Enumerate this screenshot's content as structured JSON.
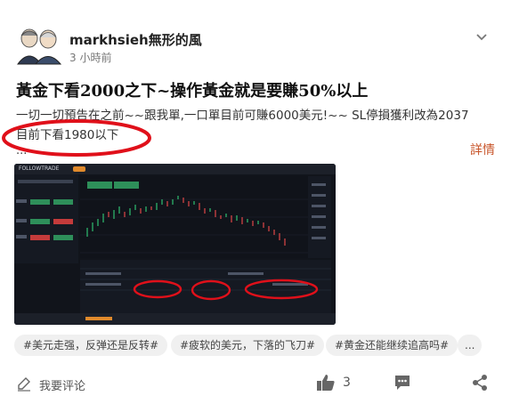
{
  "post": {
    "author": "markhsieh無形的風",
    "time": "3 小時前",
    "title": "黃金下看2000之下~操作黃金就是要賺50%以上",
    "body_line1": "一切一切預告在之前~~跟我單,一口單目前可賺6000美元!~~ SL停損獲利改為2037",
    "body_line2": "目前下看1980以下",
    "ellipsis": "...",
    "more_label": "詳情"
  },
  "screenshot": {
    "logo_text": "FOLLOWTRADE"
  },
  "tags": [
    "#美元走强，反弹还是反转#",
    "#疲软的美元，下落的飞刀#",
    "#黄金还能继续追高吗#",
    "..."
  ],
  "footer": {
    "comment_label": "我要评论",
    "like_count": "3"
  },
  "colors": {
    "accent": "#c8552a",
    "annotation_red": "#e0101a",
    "chart_bg": "#11141b",
    "candle_up": "#2fbf71",
    "candle_down": "#e04848"
  },
  "icons": [
    "chevron-down-icon",
    "comment-pen-icon",
    "thumbs-up-icon",
    "chat-bubble-icon",
    "share-icon"
  ]
}
